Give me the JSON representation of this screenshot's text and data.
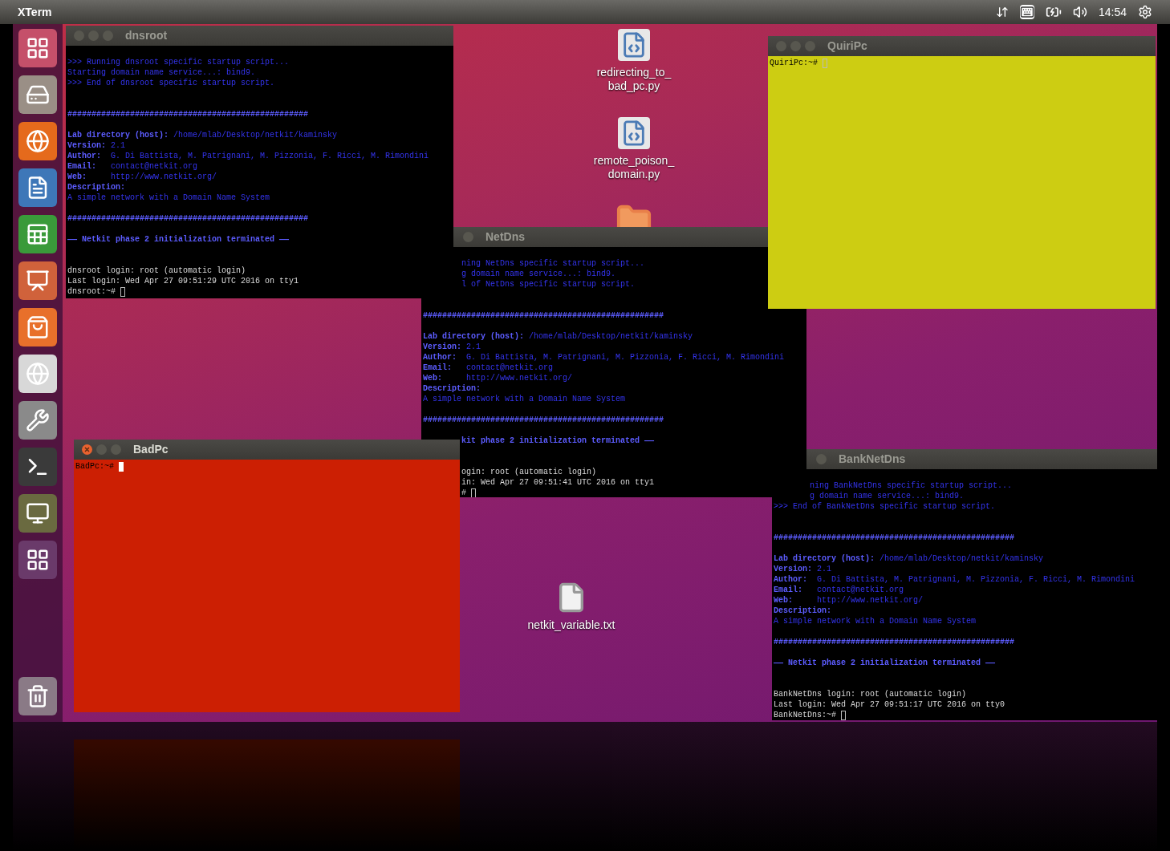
{
  "top_panel": {
    "app_title": "XTerm",
    "clock": "14:54"
  },
  "desktop_icons": [
    {
      "kind": "script",
      "label": "redirecting_to_ bad_pc.py"
    },
    {
      "kind": "script",
      "label": "remote_poison_ domain.py"
    },
    {
      "kind": "folder"
    },
    {
      "kind": "text",
      "label": "netkit_variable.txt"
    }
  ],
  "windows": [
    {
      "title": "dnsroot",
      "focused": false,
      "kind": "terminal",
      "lines": [
        {
          "kind": "blue",
          "text": ">>> Running dnsroot specific startup script..."
        },
        {
          "kind": "blue",
          "text": "Starting domain name service...: bind9."
        },
        {
          "kind": "blue",
          "text": ">>> End of dnsroot specific startup script."
        },
        {
          "kind": "blank"
        },
        {
          "kind": "blank"
        },
        {
          "kind": "bold",
          "text": "##################################################"
        },
        {
          "kind": "blank"
        },
        {
          "kind": "blue",
          "text": "**Lab directory (host):** /home/mlab/Desktop/netkit/kaminsky"
        },
        {
          "kind": "blue",
          "text": "**Version:** 2.1"
        },
        {
          "kind": "blue",
          "text": "**Author:**  G. Di Battista, M. Patrignani, M. Pizzonia, F. Ricci, M. Rimondini"
        },
        {
          "kind": "blue",
          "text": "**Email:**   contact@netkit.org"
        },
        {
          "kind": "blue",
          "text": "**Web:**     http://www.netkit.org/"
        },
        {
          "kind": "bold",
          "text": "Description:"
        },
        {
          "kind": "blue",
          "text": "A simple network with a Domain Name System"
        },
        {
          "kind": "blank"
        },
        {
          "kind": "bold",
          "text": "##################################################"
        },
        {
          "kind": "blank"
        },
        {
          "kind": "bold",
          "text": "—— Netkit phase 2 initialization terminated ——"
        },
        {
          "kind": "blank"
        },
        {
          "kind": "blank"
        },
        {
          "kind": "white",
          "text": "dnsroot login: root (automatic login)"
        },
        {
          "kind": "white",
          "text": "Last login: Wed Apr 27 09:51:29 UTC 2016 on tty1"
        },
        {
          "kind": "prompt",
          "text": "dnsroot:~# "
        }
      ]
    },
    {
      "title": "QuiriPc",
      "focused": false,
      "kind": "yellow",
      "lines": [
        {
          "kind": "prompt",
          "text": "QuiriPc:~# "
        }
      ]
    },
    {
      "title": "NetDns",
      "focused": false,
      "kind": "terminal",
      "lines": [
        {
          "kind": "blue_cut",
          "text": "ning NetDns specific startup script..."
        },
        {
          "kind": "blue_cut",
          "text": "g domain name service...: bind9."
        },
        {
          "kind": "blue_cut",
          "text": "l of NetDns specific startup script."
        },
        {
          "kind": "blank"
        },
        {
          "kind": "blank"
        },
        {
          "kind": "bold",
          "text": "##################################################"
        },
        {
          "kind": "blank"
        },
        {
          "kind": "blue",
          "text": "**Lab directory (host):** /home/mlab/Desktop/netkit/kaminsky"
        },
        {
          "kind": "blue",
          "text": "**Version:** 2.1"
        },
        {
          "kind": "blue",
          "text": "**Author:**  G. Di Battista, M. Patrignani, M. Pizzonia, F. Ricci, M. Rimondini"
        },
        {
          "kind": "blue",
          "text": "**Email:**   contact@netkit.org"
        },
        {
          "kind": "blue",
          "text": "**Web:**     http://www.netkit.org/"
        },
        {
          "kind": "bold",
          "text": "Description:"
        },
        {
          "kind": "blue",
          "text": "A simple network with a Domain Name System"
        },
        {
          "kind": "blank"
        },
        {
          "kind": "bold",
          "text": "##################################################"
        },
        {
          "kind": "blank"
        },
        {
          "kind": "bold_cut",
          "text": "kit phase 2 initialization terminated ——"
        },
        {
          "kind": "blank"
        },
        {
          "kind": "blank"
        },
        {
          "kind": "white_cut",
          "text": "ogin: root (automatic login)"
        },
        {
          "kind": "white_cut",
          "text": "in: Wed Apr 27 09:51:41 UTC 2016 on tty1"
        },
        {
          "kind": "prompt_cut",
          "text": "# "
        }
      ]
    },
    {
      "title": "BadPc",
      "focused": true,
      "kind": "red",
      "lines": [
        {
          "kind": "prompt",
          "text": "BadPc:~# "
        }
      ]
    },
    {
      "title": "BankNetDns",
      "focused": false,
      "kind": "terminal",
      "lines": [
        {
          "kind": "blue_cut",
          "text": "ning BankNetDns specific startup script..."
        },
        {
          "kind": "blue_cut",
          "text": "g domain name service...: bind9."
        },
        {
          "kind": "blue",
          "text": ">>> End of BankNetDns specific startup script."
        },
        {
          "kind": "blank"
        },
        {
          "kind": "blank"
        },
        {
          "kind": "bold",
          "text": "##################################################"
        },
        {
          "kind": "blank"
        },
        {
          "kind": "blue",
          "text": "**Lab directory (host):** /home/mlab/Desktop/netkit/kaminsky"
        },
        {
          "kind": "blue",
          "text": "**Version:** 2.1"
        },
        {
          "kind": "blue",
          "text": "**Author:**  G. Di Battista, M. Patrignani, M. Pizzonia, F. Ricci, M. Rimondini"
        },
        {
          "kind": "blue",
          "text": "**Email:**   contact@netkit.org"
        },
        {
          "kind": "blue",
          "text": "**Web:**     http://www.netkit.org/"
        },
        {
          "kind": "bold",
          "text": "Description:"
        },
        {
          "kind": "blue",
          "text": "A simple network with a Domain Name System"
        },
        {
          "kind": "blank"
        },
        {
          "kind": "bold",
          "text": "##################################################"
        },
        {
          "kind": "blank"
        },
        {
          "kind": "bold",
          "text": "—— Netkit phase 2 initialization terminated ——"
        },
        {
          "kind": "blank"
        },
        {
          "kind": "blank"
        },
        {
          "kind": "white",
          "text": "BankNetDns login: root (automatic login)"
        },
        {
          "kind": "white",
          "text": "Last login: Wed Apr 27 09:51:17 UTC 2016 on tty0"
        },
        {
          "kind": "prompt",
          "text": "BankNetDns:~# "
        }
      ]
    }
  ]
}
